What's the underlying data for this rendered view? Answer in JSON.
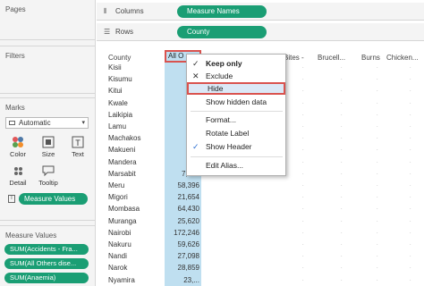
{
  "sidebar": {
    "pages_title": "Pages",
    "filters_title": "Filters",
    "marks_title": "Marks",
    "mark_type": "Automatic",
    "mark_buttons": [
      {
        "label": "Color",
        "icon": "color-icon"
      },
      {
        "label": "Size",
        "icon": "size-icon"
      },
      {
        "label": "Text",
        "icon": "text-icon"
      },
      {
        "label": "Detail",
        "icon": "detail-icon"
      },
      {
        "label": "Tooltip",
        "icon": "tooltip-icon"
      }
    ],
    "measure_values_pill": "Measure Values",
    "measure_values_title": "Measure Values",
    "sum_pills": [
      "SUM(Accidents - Fra...",
      "SUM(All Others dise...",
      "SUM(Anaemia)"
    ]
  },
  "shelves": {
    "columns_label": "Columns",
    "columns_pill": "Measure Names",
    "rows_label": "Rows",
    "rows_pill": "County"
  },
  "viz": {
    "row_header": "County",
    "all_col_header": "All O",
    "col_headers": [
      "Bites -",
      "Brucell...",
      "Burns",
      "Chicken..."
    ],
    "counties": [
      "Kisii",
      "Kisumu",
      "Kitui",
      "Kwale",
      "Laikipia",
      "Lamu",
      "Machakos",
      "Makueni",
      "Mandera",
      "Marsabit",
      "Meru",
      "Migori",
      "Mombasa",
      "Muranga",
      "Nairobi",
      "Nakuru",
      "Nandi",
      "Narok",
      "Nyamira"
    ],
    "all_values": [
      "",
      "",
      "",
      "",
      "",
      "",
      "",
      "",
      "",
      "7,091",
      "58,396",
      "21,654",
      "64,430",
      "25,620",
      "172,246",
      "59,626",
      "27,098",
      "28,859",
      "23,..."
    ]
  },
  "context_menu": {
    "items": [
      {
        "label": "Keep only",
        "mark": "✓",
        "bold": true
      },
      {
        "label": "Exclude",
        "mark": "✕",
        "bold": false
      },
      {
        "label": "Hide",
        "mark": "",
        "bold": false
      },
      {
        "label": "Show hidden data",
        "mark": "",
        "bold": false
      },
      {
        "label": "Format...",
        "mark": "",
        "bold": false
      },
      {
        "label": "Rotate Label",
        "mark": "",
        "bold": false
      },
      {
        "label": "Show Header",
        "mark": "✓",
        "bold": false
      },
      {
        "label": "Edit Alias...",
        "mark": "",
        "bold": false
      }
    ]
  },
  "colors": {
    "pill": "#1a9e74",
    "selected_column": "#bfdff0",
    "highlight_border": "#d9534f"
  }
}
